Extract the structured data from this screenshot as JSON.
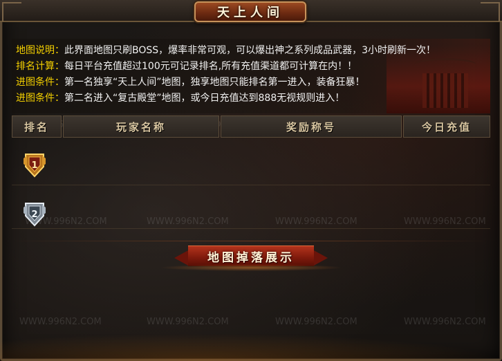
{
  "panel": {
    "title": "天上人间"
  },
  "info": [
    {
      "key": "地图说明：",
      "value": "此界面地图只刷BOSS，爆率非常可观，可以爆出神之系列成品武器，3小时刷新一次！"
    },
    {
      "key": "排名计算：",
      "value": "每日平台充值超过100元可记录排名,所有充值渠道都可计算在内！！"
    },
    {
      "key": "进图条件：",
      "value": "第一名独享“天上人间”地图，独享地图只能排名第一进入，装备狂暴！"
    },
    {
      "key": "进图条件：",
      "value": "第二名进入“复古殿堂”地图，或今日充值达到888无视规则进入！"
    }
  ],
  "table": {
    "headers": [
      "排名",
      "玩家名称",
      "奖励称号",
      "今日充值"
    ],
    "rows": [
      {
        "rank_icon": "rank-1-gold-medal-icon",
        "player": "",
        "title": "",
        "recharge": ""
      },
      {
        "rank_icon": "rank-2-silver-medal-icon",
        "player": "",
        "title": "",
        "recharge": ""
      }
    ]
  },
  "drops": {
    "title": "地图掉落展示"
  },
  "watermark": "WWW.996N2.COM",
  "colors": {
    "key": "#f4d000",
    "value": "#f2f2f2",
    "header_text": "#d9c6a1",
    "ribbon": "#9a2614"
  }
}
